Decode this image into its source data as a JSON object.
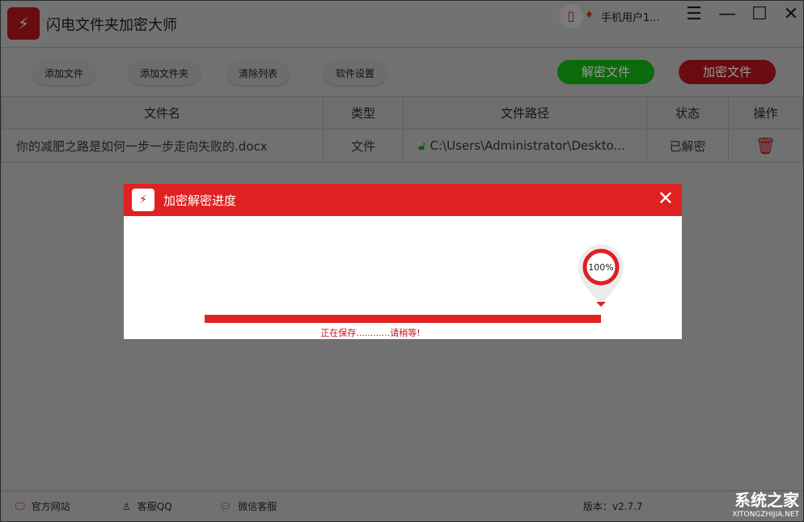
{
  "app": {
    "title": "闪电文件夹加密大师",
    "user": "手机用户1...",
    "icons": [
      "phone-icon",
      "vip-diamond-icon",
      "menu-icon",
      "minimize-icon",
      "maximize-icon",
      "close-icon"
    ]
  },
  "toolbar": {
    "add_file": "添加文件",
    "add_folder": "添加文件夹",
    "clear_list": "清除列表",
    "settings": "软件设置",
    "decrypt": "解密文件",
    "encrypt": "加密文件",
    "decrypt_color": "#0a9a0a",
    "encrypt_color": "#c0151b"
  },
  "table": {
    "headers": [
      "文件名",
      "类型",
      "文件路径",
      "状态",
      "操作"
    ],
    "rows": [
      {
        "name": "你的减肥之路是如何一步一步走向失败的.docx",
        "type": "文件",
        "path": "C:\\Users\\Administrator\\Deskto...",
        "status": "已解密"
      }
    ]
  },
  "footer": {
    "website": "官方网站",
    "qq": "客服QQ",
    "wechat": "微信客服",
    "version": "版本：v2.7.7"
  },
  "dialog": {
    "title": "加密解密进度",
    "percent_label": "100%",
    "progress": 100,
    "message": "正在保存............请稍等!",
    "accent": "#e02121"
  },
  "watermark": {
    "name": "系统之家",
    "url": "XITONGZHIJIA.NET"
  }
}
